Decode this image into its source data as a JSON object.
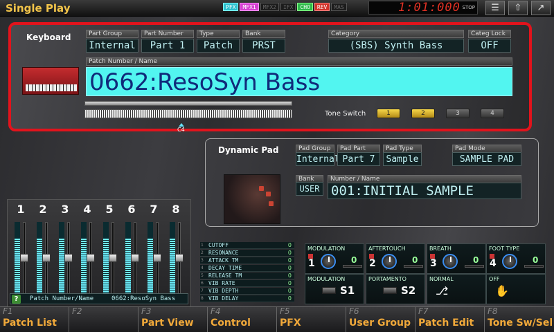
{
  "title": "Single Play",
  "effects": [
    {
      "label": "PFX",
      "state": "pfx"
    },
    {
      "label": "MFX1",
      "state": "mfx"
    },
    {
      "label": "MFX2",
      "state": "off"
    },
    {
      "label": "IFX",
      "state": "off"
    },
    {
      "label": "CHO",
      "state": "cho"
    },
    {
      "label": "REV",
      "state": "rev"
    },
    {
      "label": "MAS",
      "state": "off"
    }
  ],
  "clock": {
    "time": "1:01:000",
    "status": "STOP"
  },
  "toolbar_icons": [
    "list-icon",
    "up-arrow-icon",
    "export-icon"
  ],
  "keyboard": {
    "section_title": "Keyboard",
    "part_group_label": "Part Group",
    "part_group_value": "Internal",
    "part_number_label": "Part Number",
    "part_number_value": "Part 1",
    "type_label": "Type",
    "type_value": "Patch",
    "bank_label": "Bank",
    "bank_value": "PRST",
    "category_label": "Category",
    "category_value": "(SBS) Synth Bass",
    "catelock_label": "Categ Lock",
    "catelock_value": "OFF",
    "patch_label": "Patch Number / Name",
    "patch_name": "0662:ResoSyn Bass",
    "c4_label": "C4",
    "tone_switch_label": "Tone Switch",
    "tones": [
      {
        "label": "1",
        "on": true
      },
      {
        "label": "2",
        "on": true
      },
      {
        "label": "3",
        "on": false
      },
      {
        "label": "4",
        "on": false
      }
    ]
  },
  "pad": {
    "section_title": "Dynamic Pad",
    "group_label": "Pad Group",
    "group_value": "Internal",
    "part_label": "Pad Part",
    "part_value": "Part 7",
    "type_label": "Pad Type",
    "type_value": "Sample",
    "mode_label": "Pad Mode",
    "mode_value": "SAMPLE PAD",
    "bank_label": "Bank",
    "bank_value": "USER",
    "name_label": "Number / Name",
    "name_value": "001:INITIAL SAMPLE"
  },
  "mixer": {
    "channels": [
      {
        "num": "1",
        "level": 0.78,
        "fader": 0.52
      },
      {
        "num": "2",
        "level": 0.78,
        "fader": 0.52
      },
      {
        "num": "3",
        "level": 0.78,
        "fader": 0.52
      },
      {
        "num": "4",
        "level": 0.78,
        "fader": 0.52
      },
      {
        "num": "5",
        "level": 0.78,
        "fader": 0.52
      },
      {
        "num": "6",
        "level": 0.78,
        "fader": 0.52
      },
      {
        "num": "7",
        "level": 0.78,
        "fader": 0.52
      },
      {
        "num": "8",
        "level": 0.78,
        "fader": 0.52
      }
    ],
    "note_label": "Patch Number/Name",
    "note_value": "0662:ResoSyn Bass",
    "help_glyph": "?"
  },
  "params": [
    {
      "n": "1",
      "label": "CUTOFF",
      "value": "0"
    },
    {
      "n": "2",
      "label": "RESONANCE",
      "value": "0"
    },
    {
      "n": "3",
      "label": "ATTACK TM",
      "value": "0"
    },
    {
      "n": "4",
      "label": "DECAY TIME",
      "value": "0"
    },
    {
      "n": "5",
      "label": "RELEASE TM",
      "value": "0"
    },
    {
      "n": "6",
      "label": "VIB RATE",
      "value": "0"
    },
    {
      "n": "7",
      "label": "VIB DEPTH",
      "value": "0"
    },
    {
      "n": "8",
      "label": "VIB DELAY",
      "value": "0"
    }
  ],
  "controllers": {
    "knobs": [
      {
        "label": "MODULATION",
        "num": "1",
        "value": "0"
      },
      {
        "label": "AFTERTOUCH",
        "num": "2",
        "value": "0"
      },
      {
        "label": "BREATH",
        "num": "3",
        "value": "0"
      },
      {
        "label": "FOOT TYPE",
        "num": "4",
        "value": "0"
      }
    ],
    "switches": [
      {
        "label": "MODULATION",
        "text": "S1"
      },
      {
        "label": "PORTAMENTO",
        "text": "S2"
      },
      {
        "label": "NORMAL",
        "text": ""
      },
      {
        "label": "OFF",
        "text": ""
      }
    ]
  },
  "functions": [
    {
      "key": "F1",
      "label": "Patch List"
    },
    {
      "key": "F2",
      "label": ""
    },
    {
      "key": "F3",
      "label": "Part View"
    },
    {
      "key": "F4",
      "label": "Control"
    },
    {
      "key": "F5",
      "label": "PFX"
    },
    {
      "key": "F6",
      "label": "User Group"
    },
    {
      "key": "F7",
      "label": "Patch Edit"
    },
    {
      "key": "F8",
      "label": "Tone Sw/Sel"
    }
  ]
}
